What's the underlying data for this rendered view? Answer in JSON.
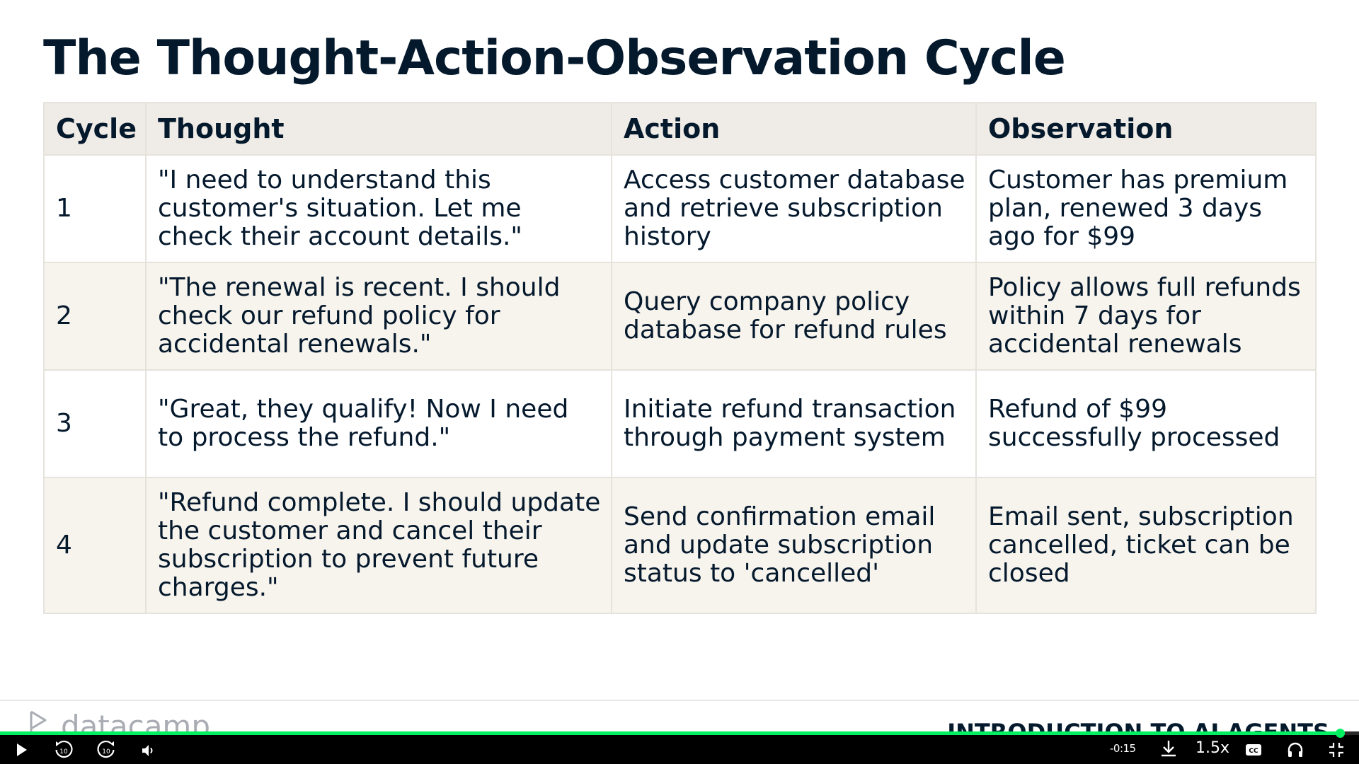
{
  "slide": {
    "title": "The Thought-Action-Observation Cycle",
    "table": {
      "headers": [
        "Cycle",
        "Thought",
        "Action",
        "Observation"
      ],
      "rows": [
        {
          "cycle": "1",
          "thought": "\"I need to understand this customer's situation. Let me check their account details.\"",
          "action": "Access customer database and retrieve subscription history",
          "observation": "Customer has premium plan, renewed 3 days ago for $99"
        },
        {
          "cycle": "2",
          "thought": "\"The renewal is recent. I should check our refund policy for accidental renewals.\"",
          "action": "Query company policy database for refund rules",
          "observation": "Policy allows full refunds within 7 days for accidental renewals"
        },
        {
          "cycle": "3",
          "thought": "\"Great, they qualify! Now I need to process the refund.\"",
          "action": "Initiate refund transaction through payment system",
          "observation": "Refund of $99 successfully processed"
        },
        {
          "cycle": "4",
          "thought": "\"Refund complete. I should update the customer and cancel their subscription to prevent future charges.\"",
          "action": "Send confirmation email and update subscription status to 'cancelled'",
          "observation": "Email sent, subscription cancelled, ticket can be closed"
        }
      ]
    },
    "footer": {
      "brand": "datacamp",
      "course_title": "INTRODUCTION TO AI AGENTS"
    }
  },
  "player": {
    "time_remaining": "-0:15",
    "playback_speed": "1.5x",
    "progress_fraction": 0.986,
    "progress_color": "#03ef62",
    "controls": {
      "play": "play-icon",
      "rewind": "rewind-10-icon",
      "forward": "forward-10-icon",
      "volume": "volume-icon",
      "download": "download-icon",
      "captions": "closed-captions-icon",
      "audio": "headphones-icon",
      "fullscreen": "exit-fullscreen-icon"
    }
  }
}
